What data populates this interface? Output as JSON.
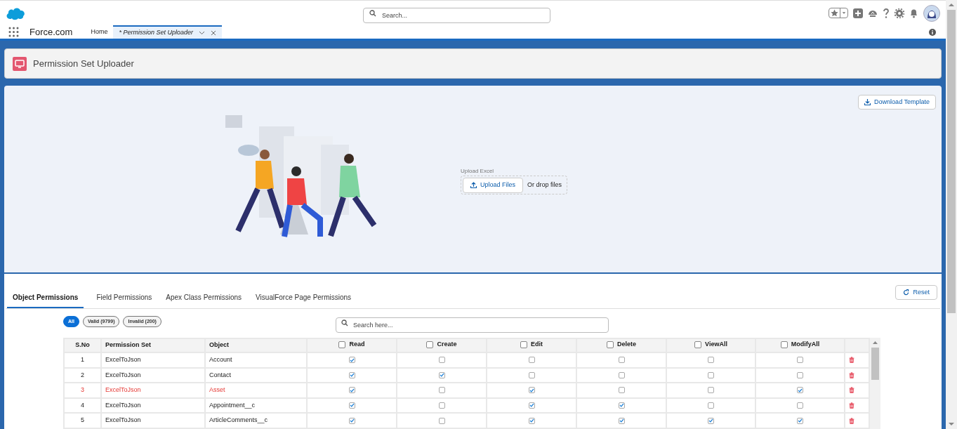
{
  "header": {
    "search_placeholder": "Search..."
  },
  "nav": {
    "app_name": "Force.com",
    "tabs": [
      {
        "label": "Home",
        "selected": false
      },
      {
        "label": "* Permission Set Uploader",
        "selected": true
      }
    ]
  },
  "page_header": {
    "title": "Permission Set Uploader"
  },
  "upload": {
    "download_button": "Download Template",
    "label": "Upload Excel",
    "button": "Upload Files",
    "drop_text": "Or drop files"
  },
  "tabs": [
    {
      "label": "Object Permissions",
      "selected": true
    },
    {
      "label": "Field Permissions",
      "selected": false
    },
    {
      "label": "Apex Class Permissions",
      "selected": false
    },
    {
      "label": "VisualForce Page Permissions",
      "selected": false
    }
  ],
  "reset_button": "Reset",
  "filters": [
    {
      "label": "All",
      "selected": true
    },
    {
      "label": "Valid (9799)",
      "selected": false
    },
    {
      "label": "Invalid (200)",
      "selected": false
    }
  ],
  "table_search_placeholder": "Search here...",
  "table": {
    "columns": [
      {
        "label": "S.No"
      },
      {
        "label": "Permission Set"
      },
      {
        "label": "Object"
      },
      {
        "label": "Read",
        "checked": false
      },
      {
        "label": "Create",
        "checked": false
      },
      {
        "label": "Edit",
        "checked": false
      },
      {
        "label": "Delete",
        "checked": false
      },
      {
        "label": "ViewAll",
        "checked": false
      },
      {
        "label": "ModifyAll",
        "checked": false
      }
    ],
    "rows": [
      {
        "sno": "1",
        "permission_set": "ExcelToJson",
        "object": "Account",
        "invalid": false,
        "perms": [
          true,
          false,
          false,
          false,
          false,
          false
        ]
      },
      {
        "sno": "2",
        "permission_set": "ExcelToJson",
        "object": "Contact",
        "invalid": false,
        "perms": [
          true,
          true,
          false,
          false,
          false,
          false
        ]
      },
      {
        "sno": "3",
        "permission_set": "ExcelToJson",
        "object": "Asset",
        "invalid": true,
        "perms": [
          true,
          false,
          true,
          false,
          false,
          true
        ]
      },
      {
        "sno": "4",
        "permission_set": "ExcelToJson",
        "object": "Appointment__c",
        "invalid": false,
        "perms": [
          true,
          false,
          true,
          true,
          false,
          false
        ]
      },
      {
        "sno": "5",
        "permission_set": "ExcelToJson",
        "object": "ArticleComments__c",
        "invalid": false,
        "perms": [
          true,
          false,
          true,
          true,
          true,
          true
        ]
      }
    ]
  }
}
